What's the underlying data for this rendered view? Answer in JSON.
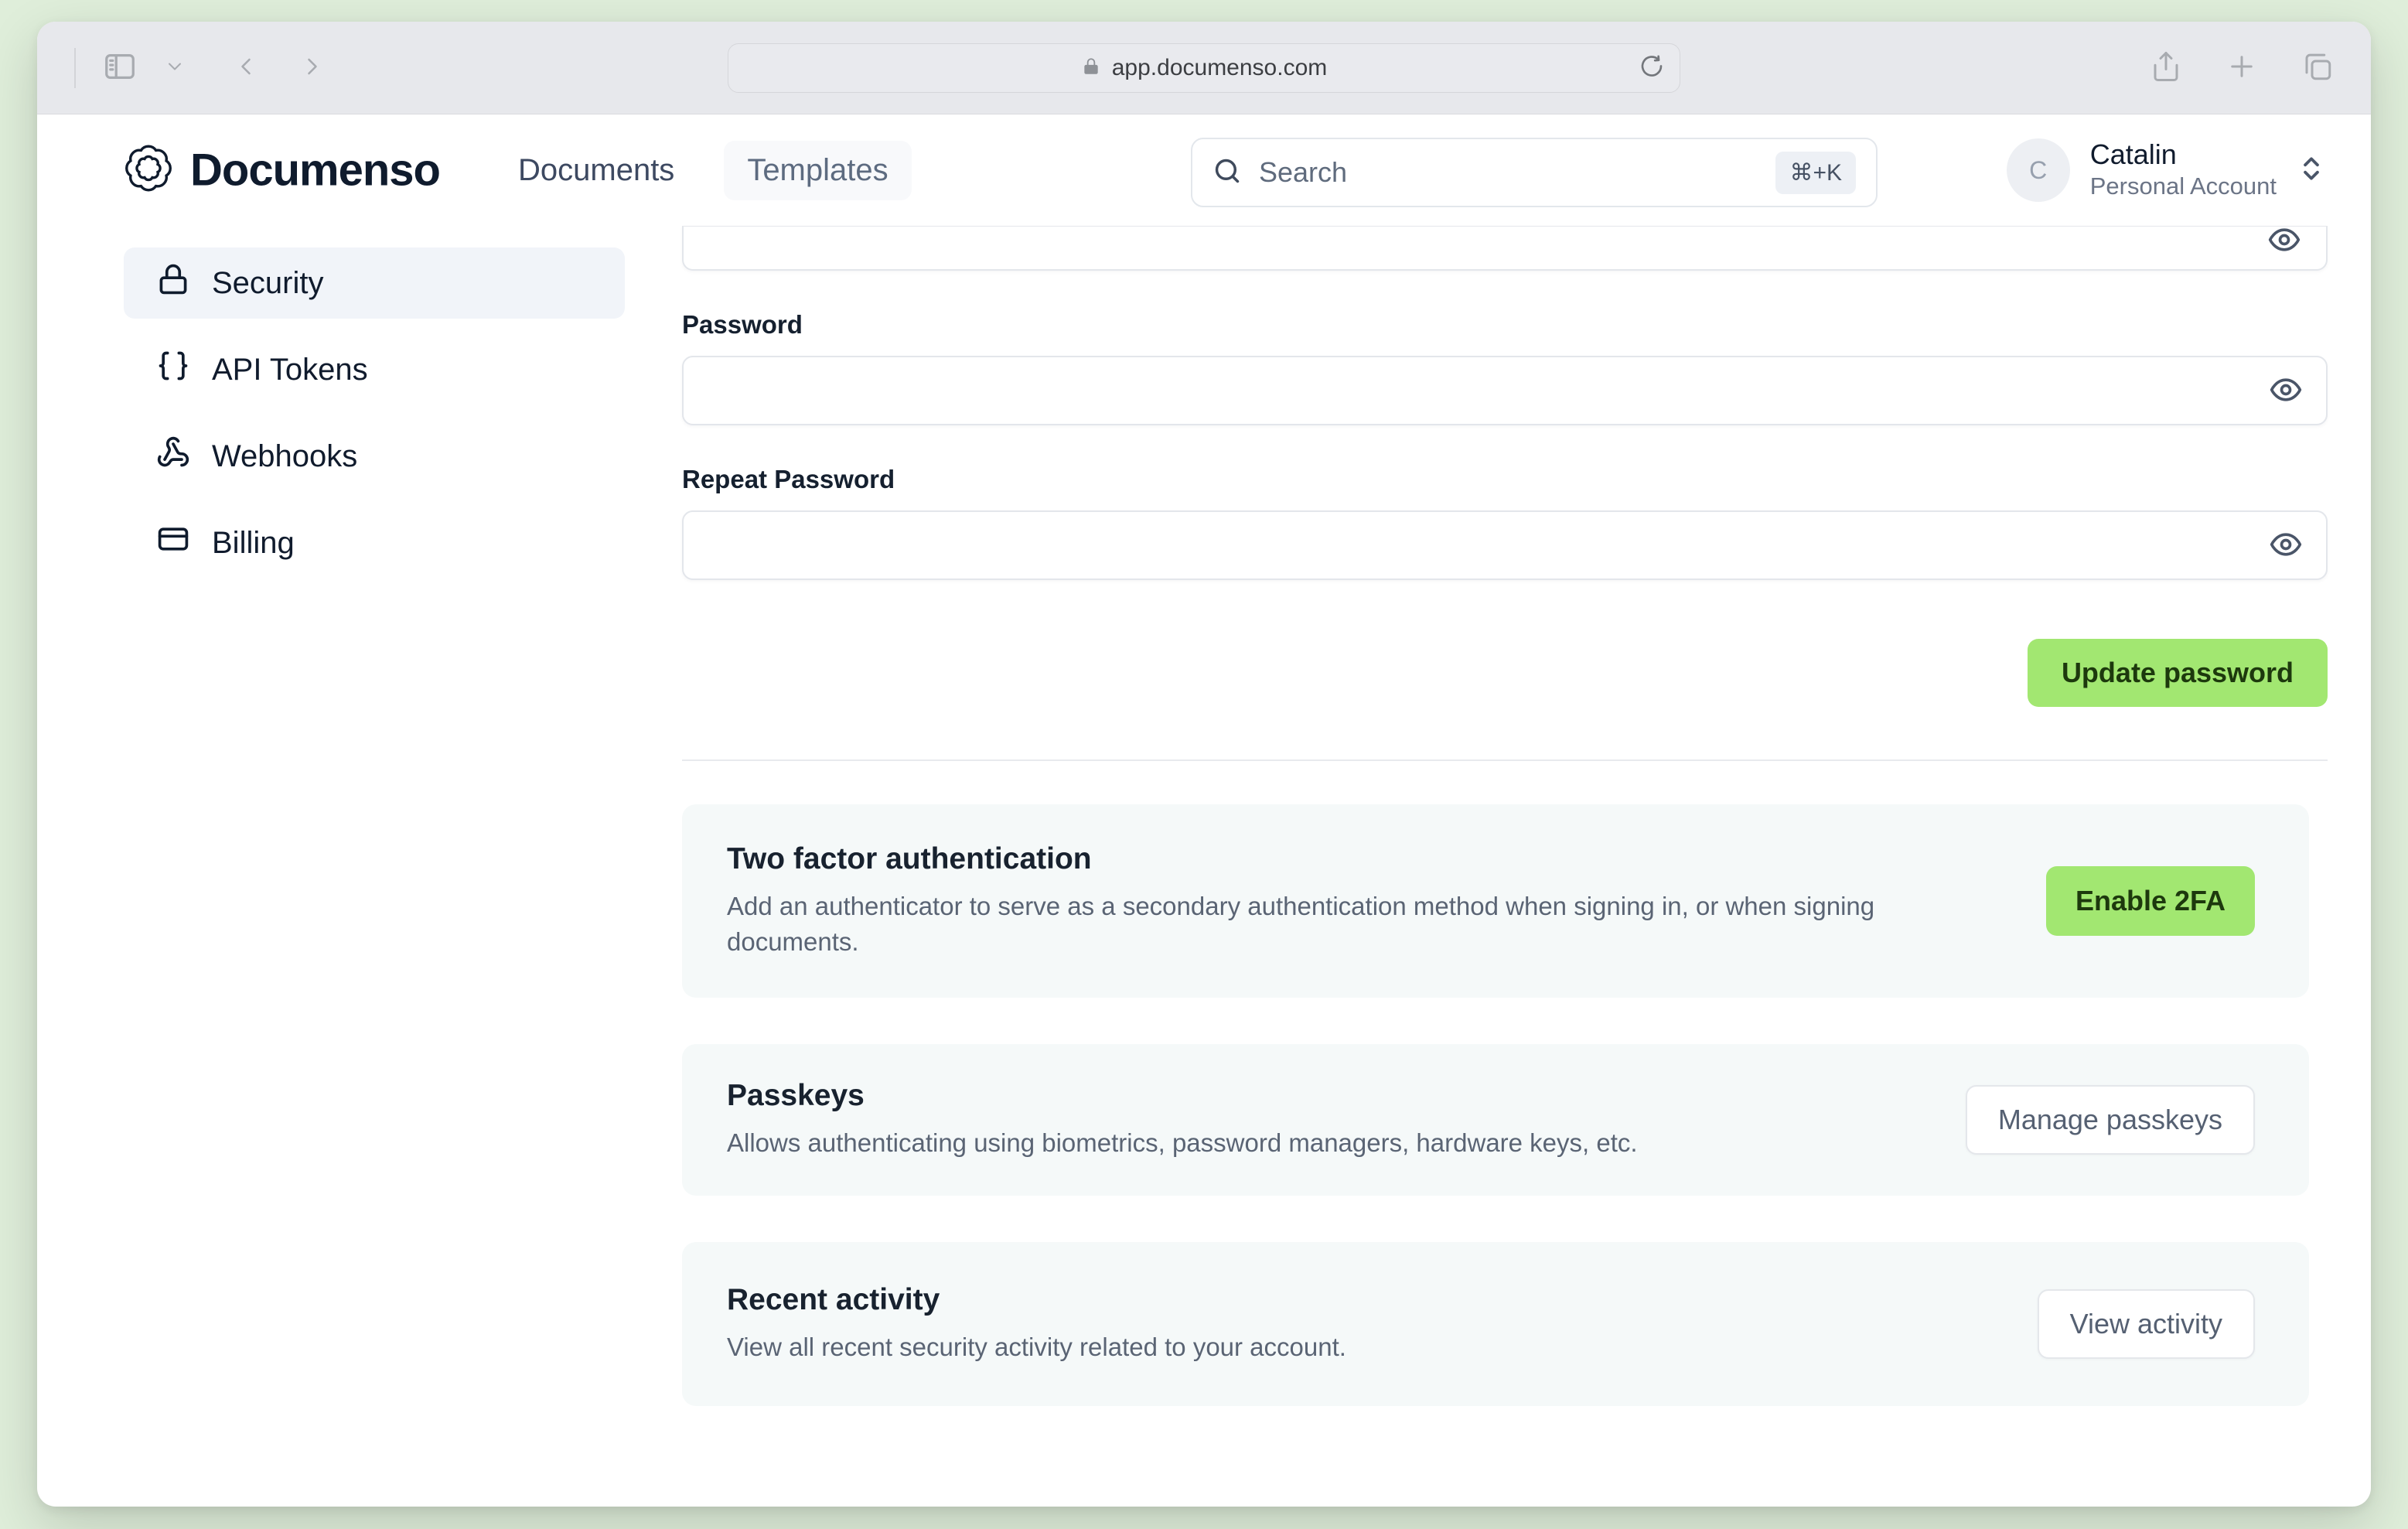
{
  "browser": {
    "url": "app.documenso.com"
  },
  "header": {
    "logo_text": "Documenso",
    "nav": [
      {
        "label": "Documents"
      },
      {
        "label": "Templates"
      }
    ],
    "search": {
      "placeholder": "Search",
      "shortcut": "⌘+K"
    },
    "account": {
      "initial": "C",
      "name": "Catalin",
      "type": "Personal Account"
    }
  },
  "sidebar": {
    "items": [
      {
        "label": "Security",
        "icon": "lock-icon",
        "active": true
      },
      {
        "label": "API Tokens",
        "icon": "braces-icon",
        "active": false
      },
      {
        "label": "Webhooks",
        "icon": "webhook-icon",
        "active": false
      },
      {
        "label": "Billing",
        "icon": "credit-card-icon",
        "active": false
      }
    ]
  },
  "main": {
    "password_form": {
      "password_label": "Password",
      "repeat_password_label": "Repeat Password",
      "submit_label": "Update password"
    },
    "sections": [
      {
        "title": "Two factor authentication",
        "description": "Add an authenticator to serve as a secondary authentication method when signing in, or when signing documents.",
        "button_label": "Enable 2FA"
      },
      {
        "title": "Passkeys",
        "description": "Allows authenticating using biometrics, password managers, hardware keys, etc.",
        "button_label": "Manage passkeys"
      },
      {
        "title": "Recent activity",
        "description": "View all recent security activity related to your account.",
        "button_label": "View activity"
      }
    ]
  },
  "colors": {
    "accent_green": "#a2e771",
    "accent_green_text": "#1d390d",
    "background_green": "#dfeeda",
    "sidebar_active_bg": "#f1f4f9",
    "card_bg": "#f5f9f9",
    "dark_navy": "#0f1b2d"
  }
}
